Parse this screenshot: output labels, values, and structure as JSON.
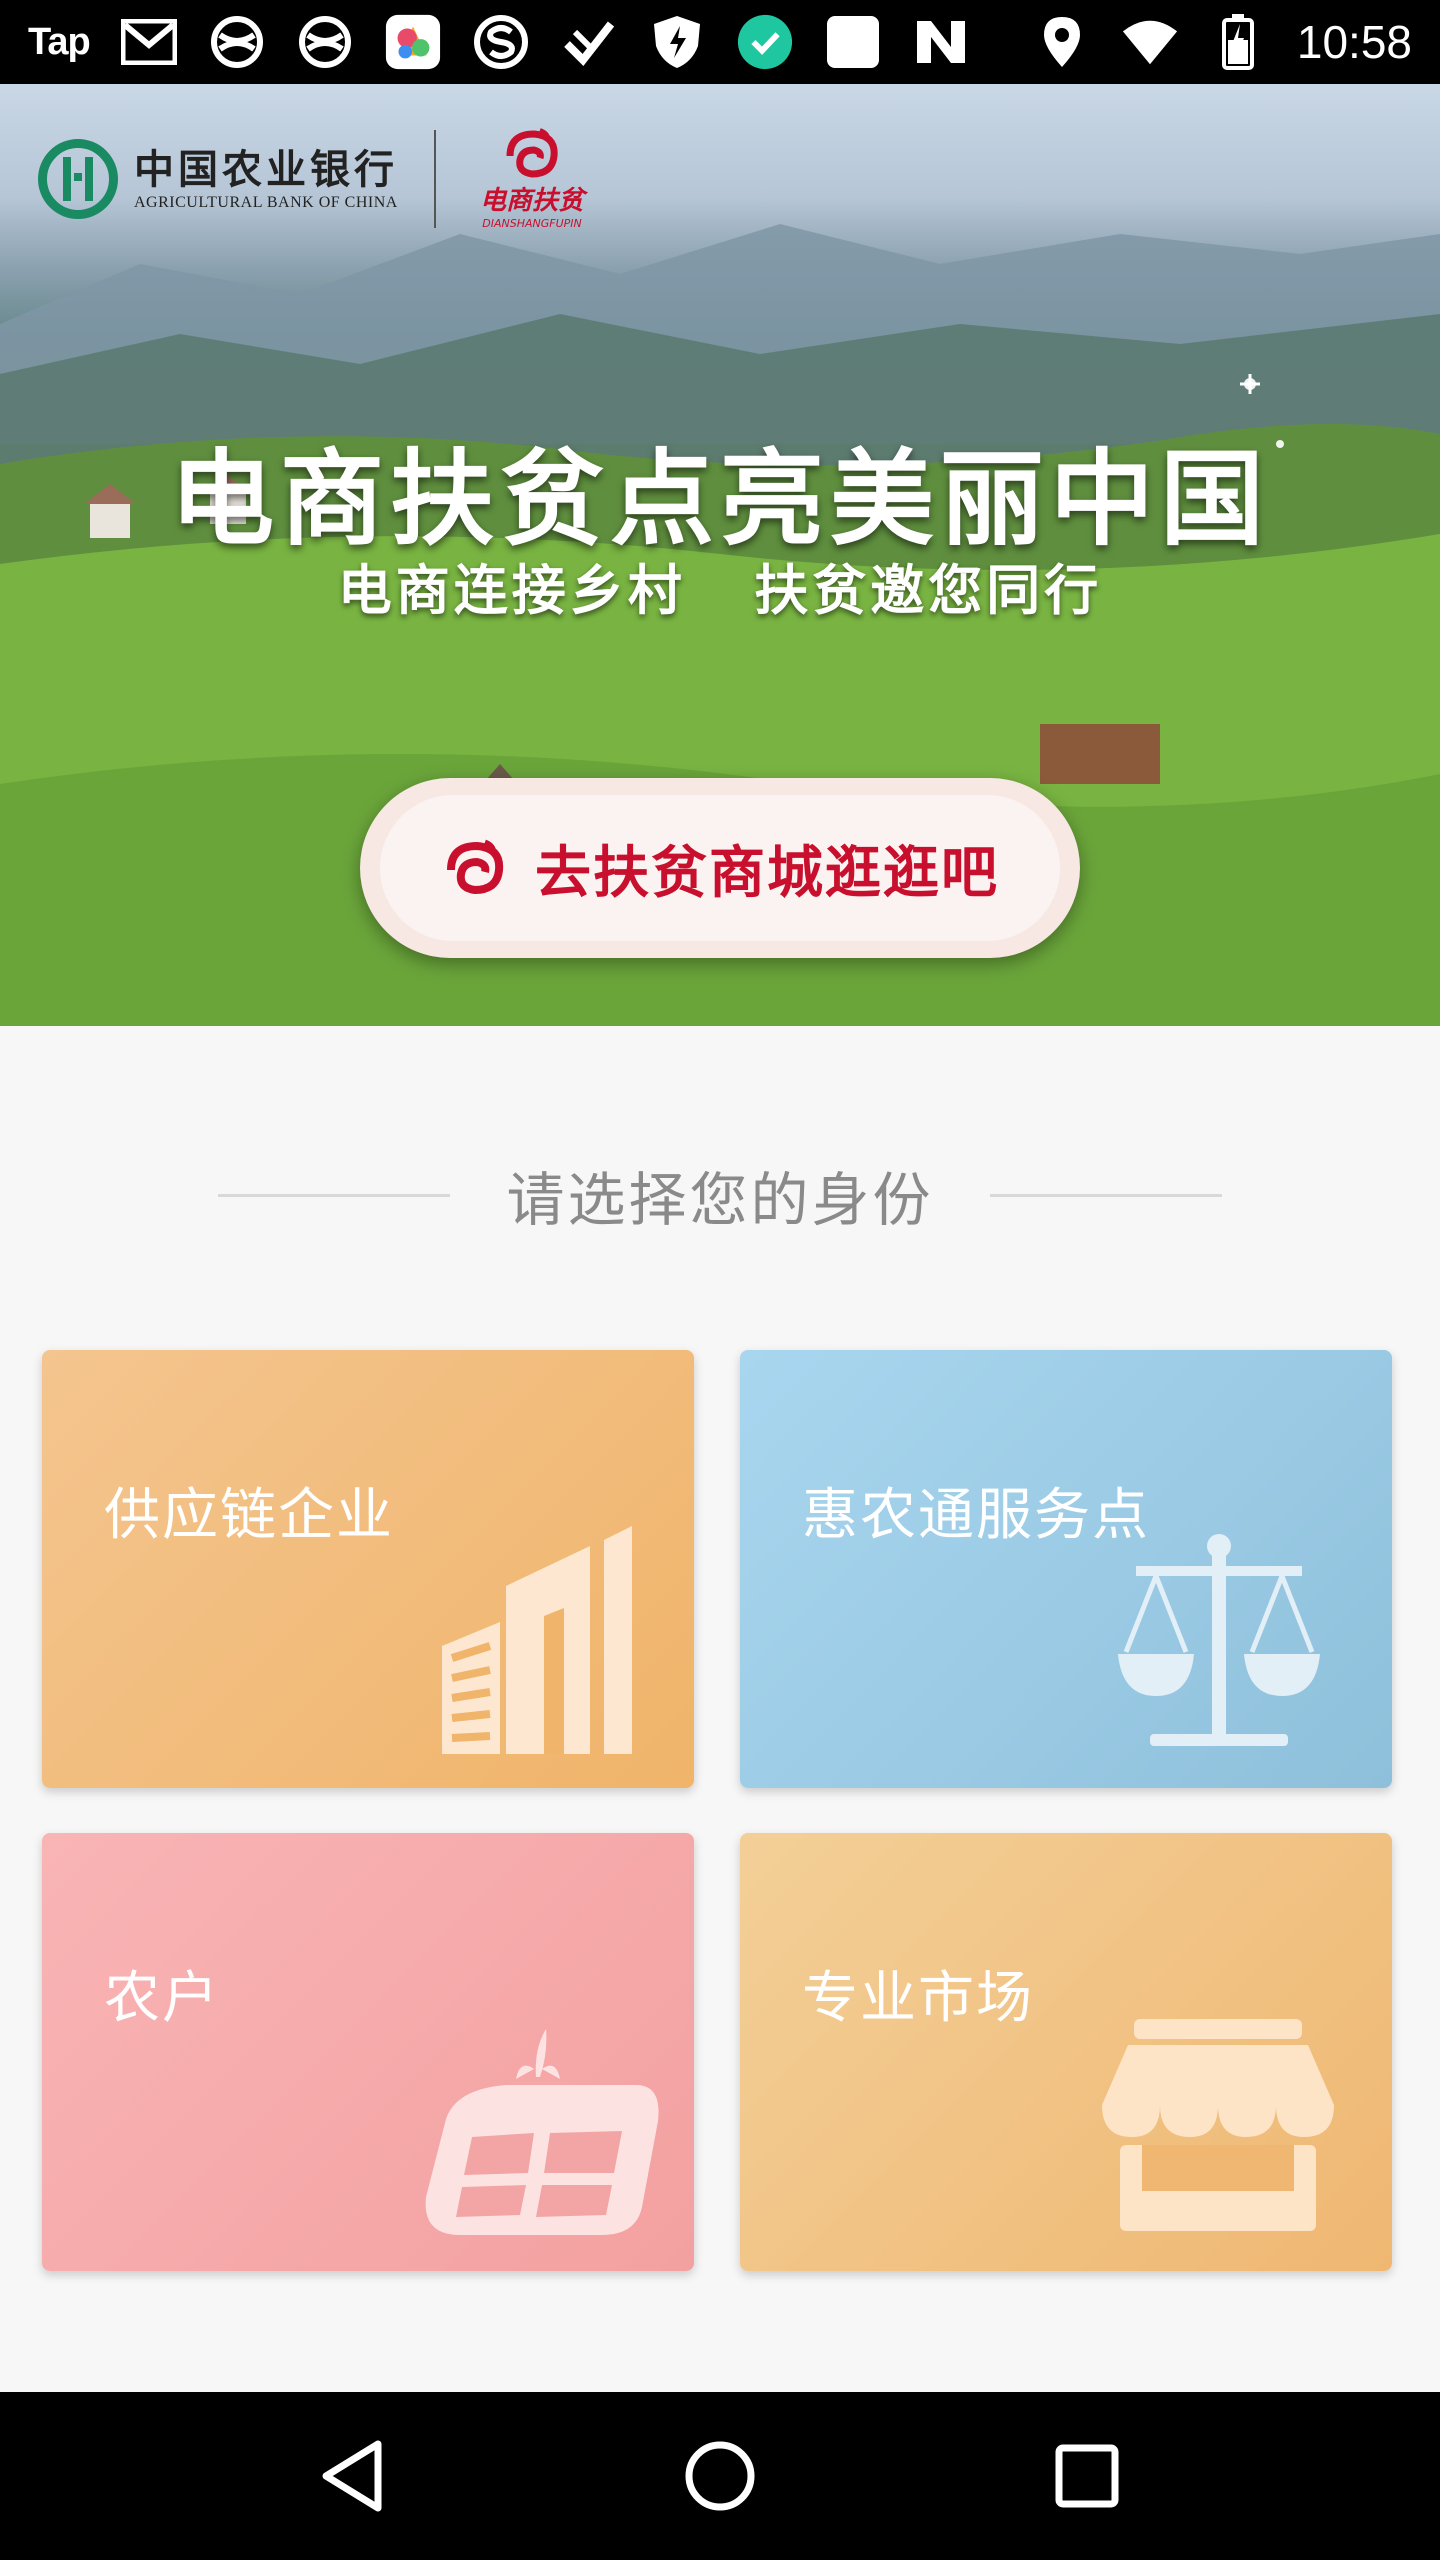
{
  "status_bar": {
    "app_label": "Tap",
    "time": "10:58",
    "icons": [
      "gmail-icon",
      "network-icon",
      "network-icon",
      "colorful-app-icon",
      "s-app-icon",
      "tool-app-icon",
      "shield-app-icon",
      "check-app-icon",
      "square-app-icon",
      "n-app-icon",
      "location-icon",
      "wifi-icon",
      "battery-icon"
    ]
  },
  "hero": {
    "bank_name_cn": "中国农业银行",
    "bank_name_en": "AGRICULTURAL BANK OF CHINA",
    "sub_brand_cn": "电商扶贫",
    "sub_brand_en": "DIANSHANGFUPIN",
    "title": "电商扶贫点亮美丽中国",
    "subtitle": "电商连接乡村   扶贫邀您同行",
    "mall_button_label": "去扶贫商城逛逛吧"
  },
  "identity": {
    "section_title": "请选择您的身份",
    "cards": [
      {
        "label": "供应链企业",
        "icon": "building-icon",
        "color": "#f0b46a"
      },
      {
        "label": "惠农通服务点",
        "icon": "scales-icon",
        "color": "#8ec0db"
      },
      {
        "label": "农户",
        "icon": "farmland-icon",
        "color": "#f3a0a0"
      },
      {
        "label": "专业市场",
        "icon": "storefront-icon",
        "color": "#efb772"
      }
    ]
  },
  "nav_bar": {
    "buttons": [
      "back-icon",
      "home-icon",
      "recents-icon"
    ]
  },
  "colors": {
    "brand_red": "#c8102e",
    "abc_green": "#1a8a63"
  }
}
